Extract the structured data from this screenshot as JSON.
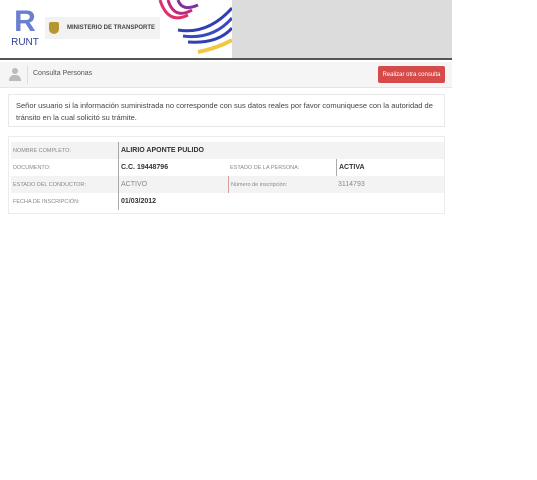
{
  "header": {
    "logo_text": "RUNT",
    "ministry": "MINISTERIO DE TRANSPORTE"
  },
  "toolbar": {
    "title": "Consulta Personas",
    "button": "Realizar otra consulta"
  },
  "alert": "Señor usuario si la información suministrada no corresponde con sus datos reales por favor comuniquese con la autoridad de tránsito en la cual solicitó su trámite.",
  "person": {
    "nombre_label": "NOMBRE COMPLETO:",
    "nombre": "ALIRIO APONTE PULIDO",
    "documento_label": "DOCUMENTO:",
    "documento": "C.C. 19448796",
    "estado_persona_label": "ESTADO DE LA PERSONA:",
    "estado_persona": "ACTIVA",
    "estado_conductor_label": "ESTADO DEL CONDUCTOR:",
    "estado_conductor": "ACTIVO",
    "inscripcion_label": "Número de inscripción:",
    "inscripcion": "3114793",
    "fecha_label": "FECHA DE INSCRIPCIÓN:",
    "fecha": "01/03/2012"
  },
  "colors": {
    "button": "#d64a4a",
    "logo": "#6a7fd0"
  }
}
